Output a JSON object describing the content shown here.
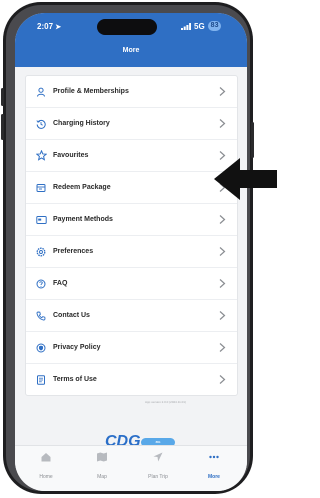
{
  "status": {
    "time": "2:07",
    "signal": "5G",
    "battery": "83"
  },
  "header": {
    "title": "More"
  },
  "menu": {
    "items": [
      {
        "label": "Profile & Memberships",
        "icon": "person-icon"
      },
      {
        "label": "Charging History",
        "icon": "history-icon"
      },
      {
        "label": "Favourites",
        "icon": "star-icon"
      },
      {
        "label": "Redeem Package",
        "icon": "package-icon"
      },
      {
        "label": "Payment Methods",
        "icon": "card-icon"
      },
      {
        "label": "Preferences",
        "icon": "gear-icon"
      },
      {
        "label": "FAQ",
        "icon": "question-icon"
      },
      {
        "label": "Contact Us",
        "icon": "phone-icon"
      },
      {
        "label": "Privacy Policy",
        "icon": "shield-icon"
      },
      {
        "label": "Terms of Use",
        "icon": "document-icon"
      }
    ]
  },
  "footer": {
    "version": "App version 2.0.0 (2024.11.01)",
    "logo_main": "CDG",
    "logo_sub": "ZIG"
  },
  "tabbar": {
    "tabs": [
      {
        "label": "Home",
        "icon": "home-icon",
        "active": false
      },
      {
        "label": "Map",
        "icon": "map-icon",
        "active": false
      },
      {
        "label": "Plan Trip",
        "icon": "navigation-icon",
        "active": false
      },
      {
        "label": "More",
        "icon": "more-dots-icon",
        "active": true
      }
    ]
  },
  "colors": {
    "primary": "#2f6fc4",
    "icon": "#2f6fc4",
    "text": "#2a2a2a",
    "chevron": "#8a8d92",
    "annotation": "#111111"
  }
}
